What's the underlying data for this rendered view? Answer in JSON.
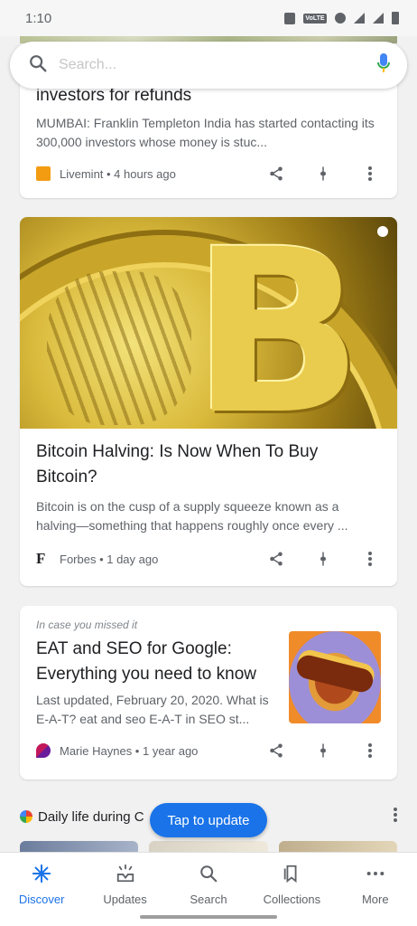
{
  "status_bar": {
    "time": "1:10",
    "volte": "VoLTE"
  },
  "search": {
    "placeholder": "Search..."
  },
  "cards": [
    {
      "title": "investors for refunds",
      "snippet": "MUMBAI: Franklin Templeton India has started contacting its 300,000 investors whose money is stuc...",
      "source": "Livemint • 4 hours ago"
    },
    {
      "title": "Bitcoin Halving: Is Now When To Buy Bitcoin?",
      "snippet": "Bitcoin is on the cusp of a supply squeeze known as a halving—something that happens roughly once every ...",
      "source": "Forbes • 1 day ago",
      "source_logo": "F"
    },
    {
      "kicker": "In case you missed it",
      "title": "EAT and SEO for Google: Everything you need to know",
      "snippet": "Last updated, February 20, 2020. What is E-A-T? eat and seo E-A-T in SEO st...",
      "source": "Marie Haynes • 1 year ago"
    }
  ],
  "daily": {
    "title": "Daily life during C"
  },
  "tap_to_update": "Tap to update",
  "nav": [
    {
      "label": "Discover",
      "icon": "asterisk-icon"
    },
    {
      "label": "Updates",
      "icon": "updates-icon"
    },
    {
      "label": "Search",
      "icon": "search-icon"
    },
    {
      "label": "Collections",
      "icon": "collections-icon"
    },
    {
      "label": "More",
      "icon": "more-dots-icon"
    }
  ],
  "colors": {
    "accent": "#1a73e8",
    "livemint": "#f39c12"
  }
}
